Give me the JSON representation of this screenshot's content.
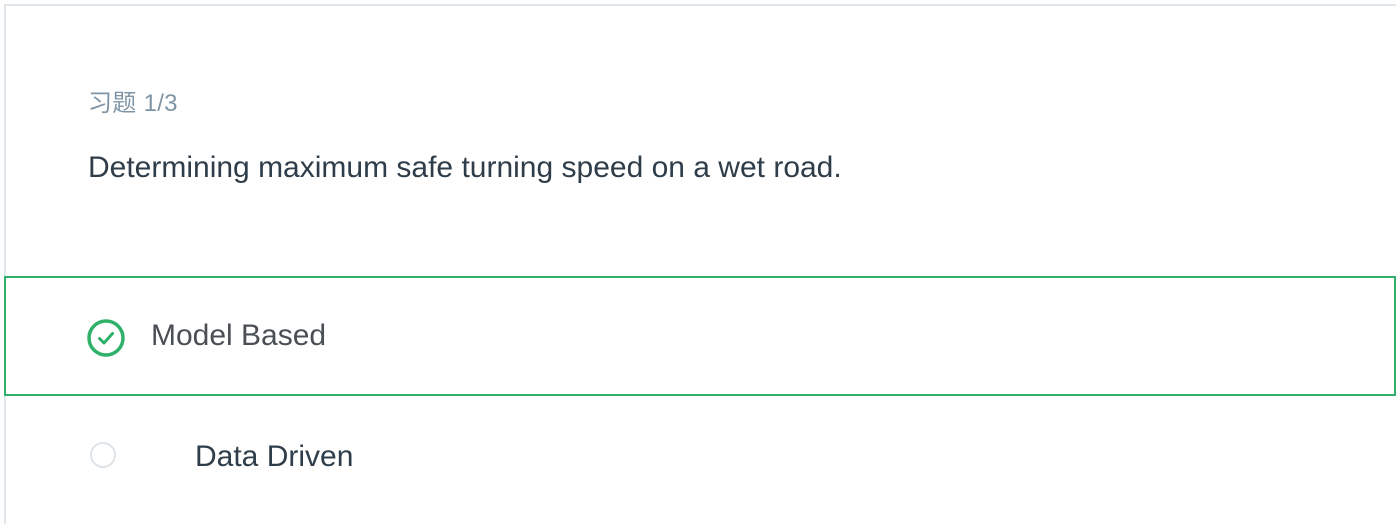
{
  "quiz": {
    "counter": "习题 1/3",
    "question": "Determining maximum safe turning speed on a wet road.",
    "options": [
      {
        "label": "Model Based",
        "selected": true
      },
      {
        "label": "Data Driven",
        "selected": false
      }
    ]
  },
  "colors": {
    "accent_green": "#2fb16a",
    "text_dark": "#2e3d49",
    "text_muted": "#7f95a6",
    "radio_border": "#dfe4e8"
  },
  "icons": {
    "selected": "check-circle-icon",
    "unselected": "radio-empty-icon"
  }
}
